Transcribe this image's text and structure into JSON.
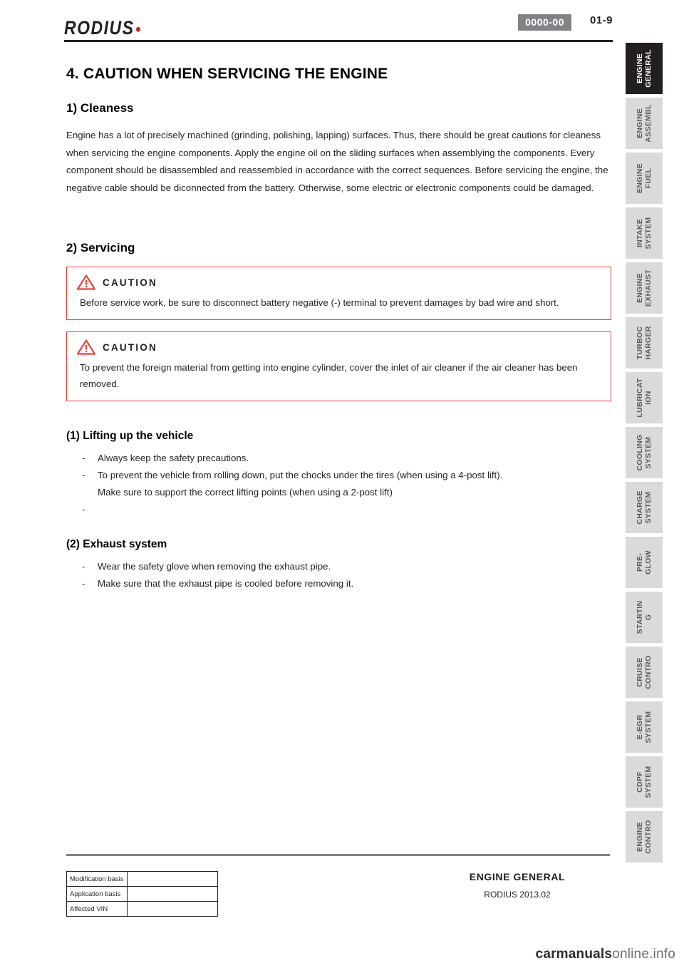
{
  "header": {
    "logo_text": "RODIUS",
    "doc_code": "0000-00",
    "page_number": "01-9"
  },
  "content": {
    "section_title": "4. CAUTION WHEN SERVICING THE ENGINE",
    "sub1_title": "1) Cleaness",
    "sub1_body": "Engine has a lot of precisely machined (grinding, polishing, lapping) surfaces. Thus, there should be great cautions for cleaness when servicing the engine components. Apply the engine oil on the sliding surfaces when assemblying the components. Every component should be disassembled and reassembled in accordance with the correct sequences. Before servicing the engine, the negative cable should be diconnected from the battery. Otherwise, some electric or electronic components could be damaged.",
    "sub2_title": "2) Servicing",
    "cautions": [
      {
        "label": "CAUTION",
        "body": "Before service work, be sure to disconnect battery negative (-) terminal to prevent damages by bad wire and short."
      },
      {
        "label": "CAUTION",
        "body": "To prevent the foreign material from getting into engine cylinder, cover the inlet of air cleaner if the air cleaner has been removed."
      }
    ],
    "item1_title": "(1) Lifting up the vehicle",
    "item1_list": [
      "Always keep the safety precautions.",
      "To prevent the vehicle from rolling down, put the chocks under the tires (when using a 4-post lift).",
      "Make sure to support the correct lifting points (when using a 2-post lift)",
      ""
    ],
    "item2_title": "(2) Exhaust system",
    "item2_list": [
      "Wear the safety glove when removing the exhaust pipe.",
      "Make sure that the exhaust pipe is cooled before removing it."
    ]
  },
  "side_tabs": [
    {
      "line1": "ENGINE",
      "line2": "GENERAL",
      "active": true
    },
    {
      "line1": "ENGINE",
      "line2": "ASSEMBL",
      "active": false
    },
    {
      "line1": "ENGINE",
      "line2": "FUEL",
      "active": false
    },
    {
      "line1": "INTAKE",
      "line2": "SYSTEM",
      "active": false
    },
    {
      "line1": "ENGINE",
      "line2": "EXHAUST",
      "active": false
    },
    {
      "line1": "TURBOC",
      "line2": "HARGER",
      "active": false
    },
    {
      "line1": "LUBRICAT",
      "line2": "ION",
      "active": false
    },
    {
      "line1": "COOLING",
      "line2": "SYSTEM",
      "active": false
    },
    {
      "line1": "CHARGE",
      "line2": "SYSTEM",
      "active": false
    },
    {
      "line1": "PRE-",
      "line2": "GLOW",
      "active": false
    },
    {
      "line1": "STARTIN",
      "line2": "G",
      "active": false
    },
    {
      "line1": "CRUISE",
      "line2": "CONTRO",
      "active": false
    },
    {
      "line1": "E-EGR",
      "line2": "SYSTEM",
      "active": false
    },
    {
      "line1": "CDPF",
      "line2": "SYSTEM",
      "active": false
    },
    {
      "line1": "ENGINE",
      "line2": "CONTRO",
      "active": false
    }
  ],
  "footer": {
    "rows": [
      {
        "label": "Modification basis",
        "value": ""
      },
      {
        "label": "Application basis",
        "value": ""
      },
      {
        "label": "Affected VIN",
        "value": ""
      }
    ],
    "title": "ENGINE GENERAL",
    "subtitle": "RODIUS 2013.02"
  },
  "watermark": {
    "bold": "carmanuals",
    "light": "online.info"
  }
}
